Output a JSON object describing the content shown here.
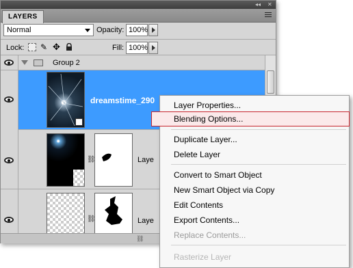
{
  "panel": {
    "tab_label": "LAYERS",
    "collapse_glyph": "◂◂",
    "close_glyph": "✕",
    "blend_mode": "Normal",
    "opacity_label": "Opacity:",
    "opacity_value": "100%",
    "lock_label": "Lock:",
    "fill_label": "Fill:",
    "fill_value": "100%"
  },
  "layers": [
    {
      "name": "Group 2",
      "type": "group"
    },
    {
      "name": "dreamstime_290",
      "type": "smart-object",
      "selected": true
    },
    {
      "name": "Laye",
      "type": "masked"
    },
    {
      "name": "Laye",
      "type": "masked"
    }
  ],
  "context_menu": {
    "items": [
      {
        "label": "Layer Properties...",
        "enabled": true
      },
      {
        "label": "Blending Options...",
        "enabled": true,
        "highlighted": true
      },
      {
        "label": "Duplicate Layer...",
        "enabled": true
      },
      {
        "label": "Delete Layer",
        "enabled": true
      },
      {
        "label": "Convert to Smart Object",
        "enabled": true
      },
      {
        "label": "New Smart Object via Copy",
        "enabled": true
      },
      {
        "label": "Edit Contents",
        "enabled": true
      },
      {
        "label": "Export Contents...",
        "enabled": true
      },
      {
        "label": "Replace Contents...",
        "enabled": false
      },
      {
        "label": "Rasterize Layer",
        "enabled": false
      }
    ]
  },
  "colors": {
    "selection": "#3d9bff",
    "highlight_border": "#c8262f"
  }
}
